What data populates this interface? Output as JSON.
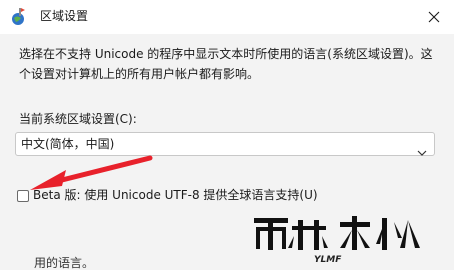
{
  "window": {
    "title": "区域设置",
    "close_icon": "close-icon",
    "app_icon": "region-settings-icon"
  },
  "content": {
    "description_line1": "选择在不支持 Unicode 的程序中显示文本时所使用的语言(系统区域设置)。这",
    "description_line2": "个设置对计算机上的所有用户帐户都有影响。",
    "current_locale_label": "当前系统区域设置(C):",
    "current_locale_value": "中文(简体，中国)",
    "beta_label": "Beta 版: 使用 Unicode UTF-8 提供全球语言支持(U)",
    "beta_checked": false,
    "partial_bottom_text": "用的语言。"
  },
  "annotation": {
    "arrow_color": "#e8212b"
  },
  "watermark": {
    "brand_text": "YLMF",
    "logo_name": "watermark-logo"
  }
}
